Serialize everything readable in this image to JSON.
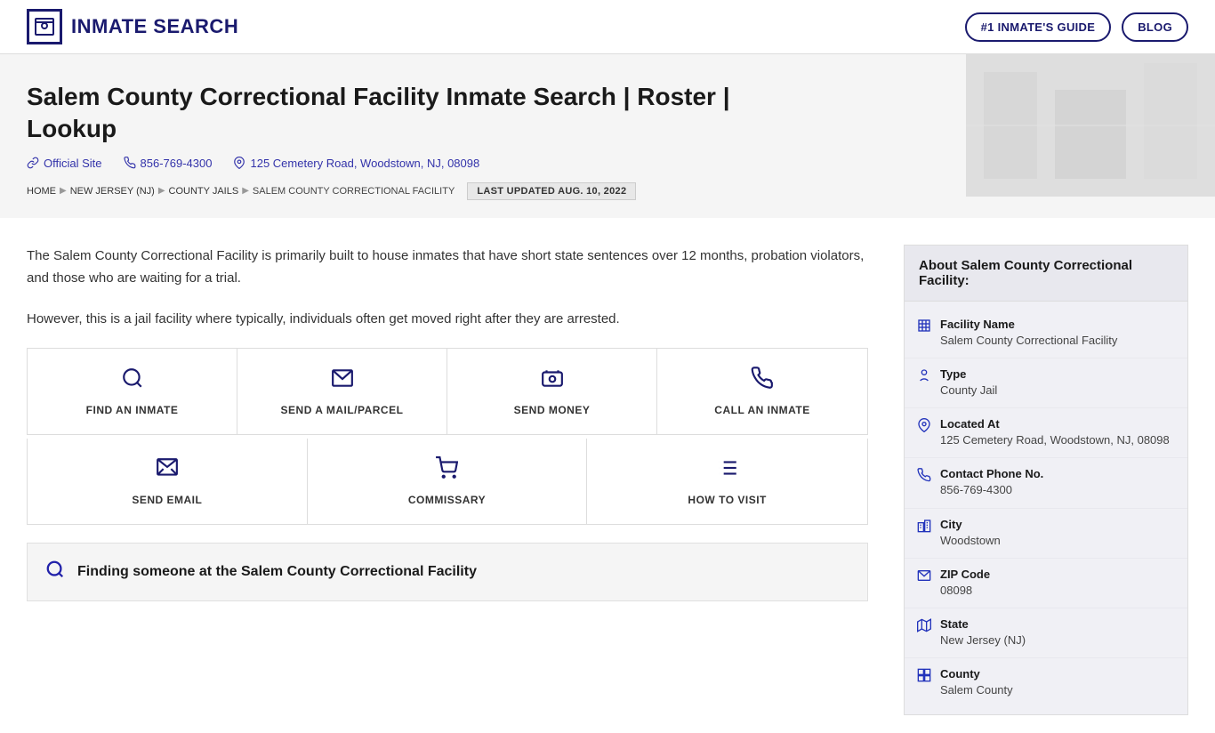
{
  "header": {
    "logo_text": "INMATE SEARCH",
    "nav": {
      "guide_label": "#1 INMATE'S GUIDE",
      "blog_label": "BLOG"
    }
  },
  "hero": {
    "title": "Salem County Correctional Facility Inmate Search | Roster | Lookup",
    "official_site_label": "Official Site",
    "phone": "856-769-4300",
    "address": "125 Cemetery Road, Woodstown, NJ, 08098",
    "breadcrumb": {
      "home": "HOME",
      "state": "NEW JERSEY (NJ)",
      "category": "COUNTY JAILS",
      "current": "SALEM COUNTY CORRECTIONAL FACILITY"
    },
    "last_updated": "LAST UPDATED AUG. 10, 2022"
  },
  "description": {
    "para1": "The Salem County Correctional Facility is primarily built to house inmates that have short state sentences over 12 months, probation violators, and those who are waiting for a trial.",
    "para2": "However, this is a jail facility where typically, individuals often get moved right after they are arrested."
  },
  "actions": {
    "row1": [
      {
        "label": "FIND AN INMATE",
        "icon": "search"
      },
      {
        "label": "SEND A MAIL/PARCEL",
        "icon": "mail"
      },
      {
        "label": "SEND MONEY",
        "icon": "money"
      },
      {
        "label": "CALL AN INMATE",
        "icon": "phone"
      }
    ],
    "row2": [
      {
        "label": "SEND EMAIL",
        "icon": "email"
      },
      {
        "label": "COMMISSARY",
        "icon": "cart"
      },
      {
        "label": "HOW TO VISIT",
        "icon": "list"
      }
    ]
  },
  "find_section": {
    "text": "Finding someone at the Salem County Correctional Facility"
  },
  "about": {
    "title": "About Salem County Correctional Facility:",
    "items": [
      {
        "label": "Facility Name",
        "value": "Salem County Correctional Facility",
        "icon": "building"
      },
      {
        "label": "Type",
        "value": "County Jail",
        "icon": "person"
      },
      {
        "label": "Located At",
        "value": "125 Cemetery Road, Woodstown, NJ, 08098",
        "icon": "location"
      },
      {
        "label": "Contact Phone No.",
        "value": "856-769-4300",
        "icon": "phone"
      },
      {
        "label": "City",
        "value": "Woodstown",
        "icon": "city"
      },
      {
        "label": "ZIP Code",
        "value": "08098",
        "icon": "mail"
      },
      {
        "label": "State",
        "value": "New Jersey (NJ)",
        "icon": "map"
      },
      {
        "label": "County",
        "value": "Salem County",
        "icon": "grid"
      }
    ]
  }
}
